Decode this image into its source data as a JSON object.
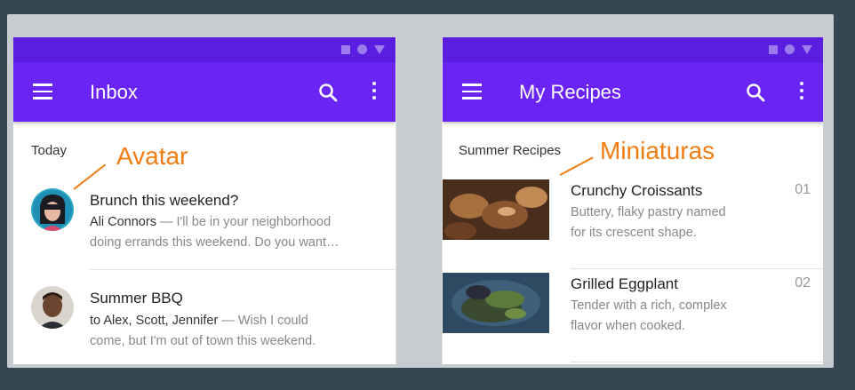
{
  "inbox": {
    "title": "Inbox",
    "section": "Today",
    "items": [
      {
        "title": "Brunch this weekend?",
        "sender": "Ali Connors",
        "preview_line1": " — I'll be in your neighborhood",
        "preview_line2": "doing errands this weekend. Do you want…"
      },
      {
        "title": "Summer BBQ",
        "sender": "to Alex, Scott, Jennifer",
        "preview_line1": " — Wish I could",
        "preview_line2": "come, but I'm out of town this weekend."
      }
    ]
  },
  "recipes": {
    "title": "My Recipes",
    "section": "Summer Recipes",
    "items": [
      {
        "title": "Crunchy Croissants",
        "desc_line1": "Buttery, flaky pastry named",
        "desc_line2": "for its crescent shape.",
        "num": "01"
      },
      {
        "title": "Grilled Eggplant",
        "desc_line1": "Tender with a rich, complex",
        "desc_line2": "flavor when cooked.",
        "num": "02"
      }
    ]
  },
  "annotations": {
    "avatar": "Avatar",
    "thumbnails": "Miniaturas"
  },
  "icons": [
    "menu-icon",
    "search-icon",
    "more-vert-icon",
    "status-square-icon",
    "status-circle-icon",
    "status-triangle-icon"
  ],
  "colors": {
    "appbar": "#6a24f5",
    "statusbar": "#5a1ee0",
    "annotation": "#f07c12",
    "background": "#34464f"
  }
}
